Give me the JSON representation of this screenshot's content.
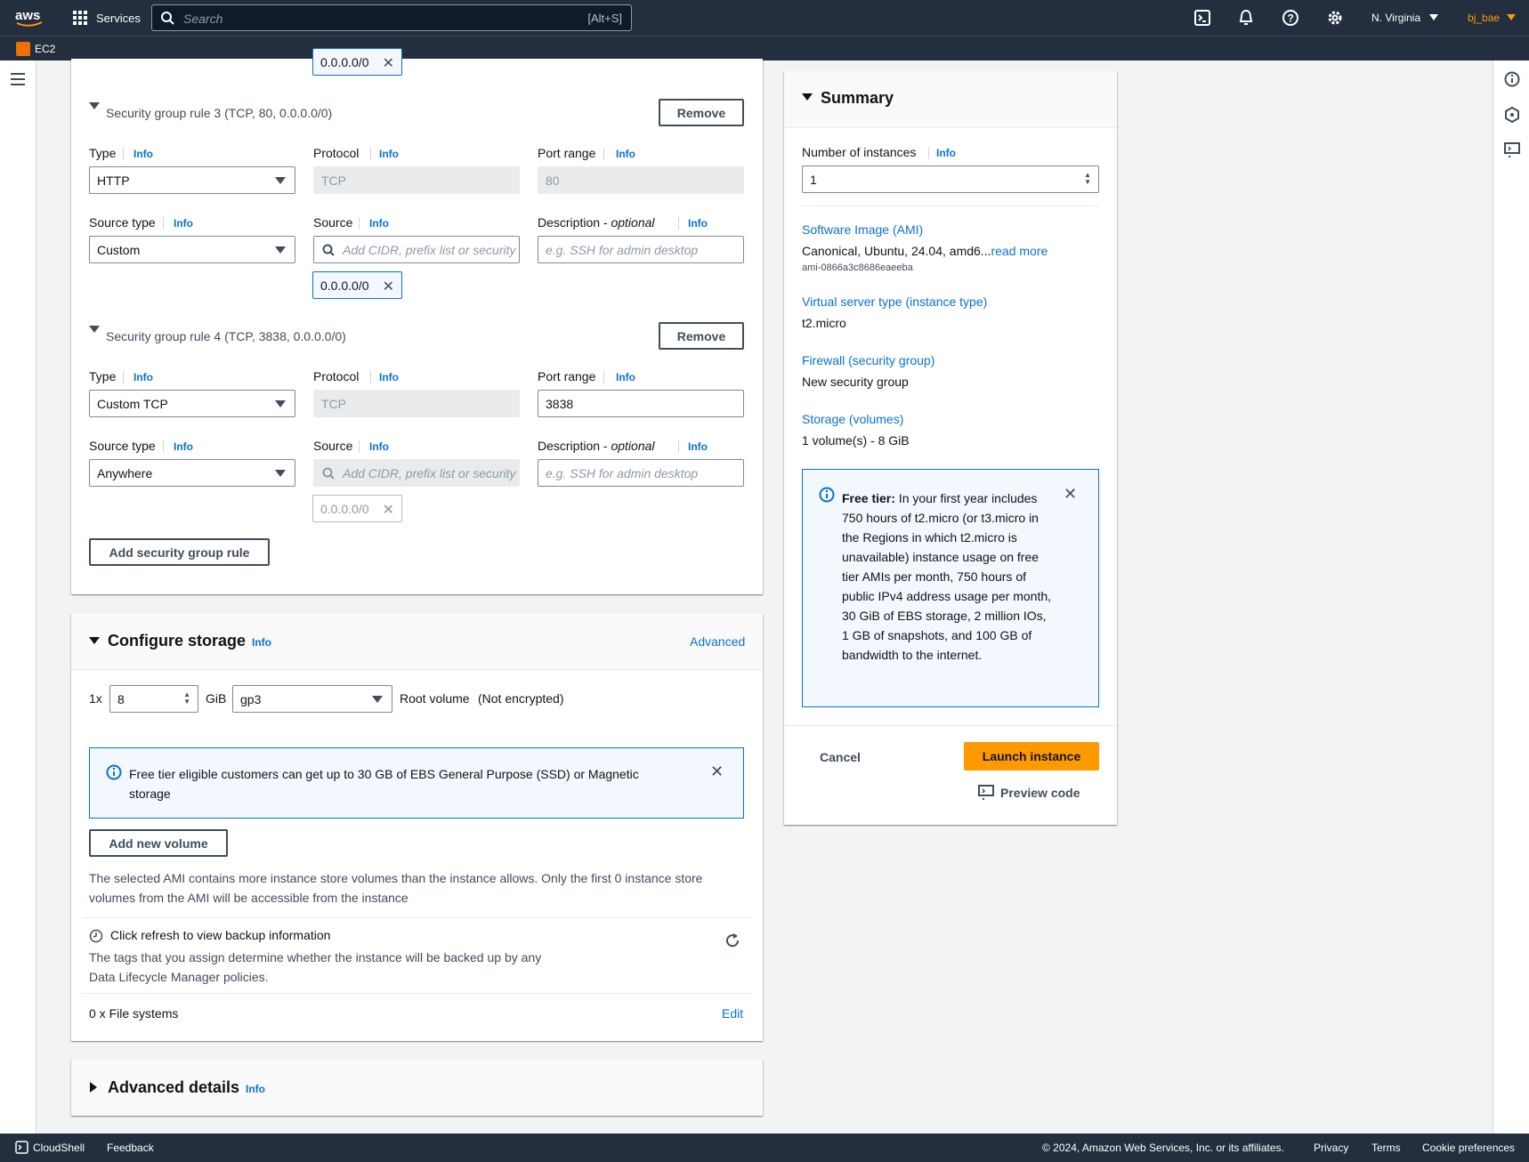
{
  "nav": {
    "services": "Services",
    "search_placeholder": "Search",
    "search_shortcut": "[Alt+S]",
    "region": "N. Virginia",
    "user": "bj_bae",
    "service": "EC2"
  },
  "sg": {
    "top_token": "0.0.0.0/0",
    "rule3": {
      "header": "Security group rule 3 (TCP, 80, 0.0.0.0/0)",
      "remove": "Remove",
      "type_label": "Type",
      "type_value": "HTTP",
      "protocol_label": "Protocol",
      "protocol_value": "TCP",
      "port_label": "Port range",
      "port_value": "80",
      "source_type_label": "Source type",
      "source_type_value": "Custom",
      "source_label": "Source",
      "source_placeholder": "Add CIDR, prefix list or security",
      "desc_label": "Description - ",
      "desc_optional": "optional",
      "desc_placeholder": "e.g. SSH for admin desktop",
      "token": "0.0.0.0/0"
    },
    "rule4": {
      "header": "Security group rule 4 (TCP, 3838, 0.0.0.0/0)",
      "remove": "Remove",
      "type_label": "Type",
      "type_value": "Custom TCP",
      "protocol_label": "Protocol",
      "protocol_value": "TCP",
      "port_label": "Port range",
      "port_value": "3838",
      "source_type_label": "Source type",
      "source_type_value": "Anywhere",
      "source_label": "Source",
      "source_placeholder": "Add CIDR, prefix list or security",
      "desc_label": "Description - ",
      "desc_optional": "optional",
      "desc_placeholder": "e.g. SSH for admin desktop",
      "token": "0.0.0.0/0"
    },
    "add_rule": "Add security group rule",
    "info": "Info"
  },
  "storage": {
    "title": "Configure storage",
    "info": "Info",
    "advanced": "Advanced",
    "count_prefix": "1x",
    "size": "8",
    "unit": "GiB",
    "volume_type": "gp3",
    "root": "Root volume",
    "encrypted": "(Not encrypted)",
    "alert": "Free tier eligible customers can get up to 30 GB of EBS General Purpose (SSD) or Magnetic storage",
    "add_volume": "Add new volume",
    "ami_note": "The selected AMI contains more instance store volumes than the instance allows. Only the first 0 instance store volumes from the AMI will be accessible from the instance",
    "backup_title": "Click refresh to view backup information",
    "backup_desc": "The tags that you assign determine whether the instance will be backed up by any Data Lifecycle Manager policies.",
    "file_systems": "0 x File systems",
    "edit": "Edit"
  },
  "advanced": {
    "title": "Advanced details",
    "info": "Info"
  },
  "summary": {
    "title": "Summary",
    "instances_label": "Number of instances",
    "info": "Info",
    "instances_value": "1",
    "ami_label": "Software Image (AMI)",
    "ami_value": "Canonical, Ubuntu, 24.04, amd6...",
    "read_more": "read more",
    "ami_id": "ami-0866a3c8686eaeeba",
    "type_label": "Virtual server type (instance type)",
    "type_value": "t2.micro",
    "fw_label": "Firewall (security group)",
    "fw_value": "New security group",
    "storage_label": "Storage (volumes)",
    "storage_value": "1 volume(s) - 8 GiB",
    "free_tier_bold": "Free tier:",
    "free_tier_text": " In your first year includes 750 hours of t2.micro (or t3.micro in the Regions in which t2.micro is unavailable) instance usage on free tier AMIs per month, 750 hours of public IPv4 address usage per month, 30 GiB of EBS storage, 2 million IOs, 1 GB of snapshots, and 100 GB of bandwidth to the internet.",
    "cancel": "Cancel",
    "launch": "Launch instance",
    "preview": "Preview code"
  },
  "footer": {
    "cloudshell": "CloudShell",
    "feedback": "Feedback",
    "copyright": "© 2024, Amazon Web Services, Inc. or its affiliates.",
    "privacy": "Privacy",
    "terms": "Terms",
    "cookies": "Cookie preferences"
  },
  "colors": {
    "nav_bg": "#232f3e",
    "link": "#0972d3",
    "primary": "#ff9900",
    "user": "#ff9900"
  }
}
